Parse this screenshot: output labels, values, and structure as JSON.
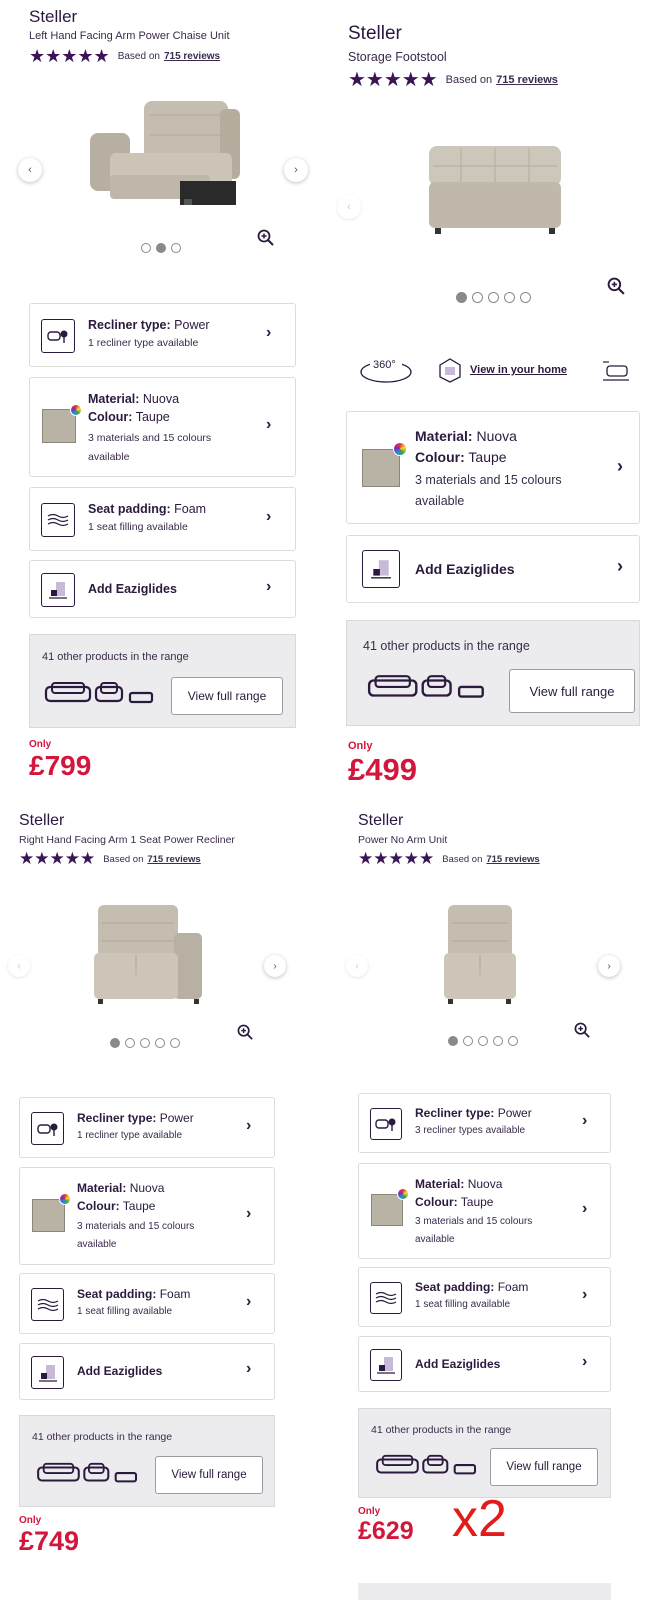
{
  "panels": [
    {
      "brand": "Steller",
      "name": "Left Hand Facing Arm Power Chaise Unit",
      "rating": {
        "stars": "★★★★★",
        "based_on": "Based on",
        "reviews": "715 reviews"
      },
      "carousel": {
        "slides": 3,
        "active": 2
      },
      "options": [
        {
          "type": "recliner",
          "label": "Recliner type:",
          "value": "Power",
          "sub": "1 recliner type available"
        },
        {
          "type": "material",
          "label": "Material:",
          "value": "Nuova",
          "label2": "Colour:",
          "value2": "Taupe",
          "sub": "3 materials and 15 colours available"
        },
        {
          "type": "padding",
          "label": "Seat padding:",
          "value": "Foam",
          "sub": "1 seat filling available"
        },
        {
          "type": "glides",
          "label": "Add Eaziglides"
        }
      ],
      "range": {
        "text": "41 other products in the range",
        "button": "View full range"
      },
      "price": {
        "prefix": "Only",
        "value": "£799"
      }
    },
    {
      "brand": "Steller",
      "name": "Storage Footstool",
      "rating": {
        "stars": "★★★★★",
        "based_on": "Based on",
        "reviews": "715 reviews"
      },
      "carousel": {
        "slides": 5,
        "active": 1
      },
      "tools": {
        "rotate": "360°",
        "view_home": "View in your home"
      },
      "options": [
        {
          "type": "material",
          "label": "Material:",
          "value": "Nuova",
          "label2": "Colour:",
          "value2": "Taupe",
          "sub": "3 materials and 15 colours available"
        },
        {
          "type": "glides",
          "label": "Add Eaziglides"
        }
      ],
      "range": {
        "text": "41 other products in the range",
        "button": "View full range"
      },
      "price": {
        "prefix": "Only",
        "value": "£499"
      }
    },
    {
      "brand": "Steller",
      "name": "Right Hand Facing Arm 1 Seat Power Recliner",
      "rating": {
        "stars": "★★★★★",
        "based_on": "Based on",
        "reviews": "715 reviews"
      },
      "carousel": {
        "slides": 5,
        "active": 1
      },
      "options": [
        {
          "type": "recliner",
          "label": "Recliner type:",
          "value": "Power",
          "sub": "1 recliner type available"
        },
        {
          "type": "material",
          "label": "Material:",
          "value": "Nuova",
          "label2": "Colour:",
          "value2": "Taupe",
          "sub": "3 materials and 15 colours available"
        },
        {
          "type": "padding",
          "label": "Seat padding:",
          "value": "Foam",
          "sub": "1 seat filling available"
        },
        {
          "type": "glides",
          "label": "Add Eaziglides"
        }
      ],
      "range": {
        "text": "41 other products in the range",
        "button": "View full range"
      },
      "price": {
        "prefix": "Only",
        "value": "£749"
      }
    },
    {
      "brand": "Steller",
      "name": "Power No Arm Unit",
      "rating": {
        "stars": "★★★★★",
        "based_on": "Based on",
        "reviews": "715 reviews"
      },
      "carousel": {
        "slides": 5,
        "active": 1
      },
      "options": [
        {
          "type": "recliner",
          "label": "Recliner type:",
          "value": "Power",
          "sub": "3 recliner types available"
        },
        {
          "type": "material",
          "label": "Material:",
          "value": "Nuova",
          "label2": "Colour:",
          "value2": "Taupe",
          "sub": "3 materials and 15 colours available"
        },
        {
          "type": "padding",
          "label": "Seat padding:",
          "value": "Foam",
          "sub": "1 seat filling available"
        },
        {
          "type": "glides",
          "label": "Add Eaziglides"
        }
      ],
      "range": {
        "text": "41 other products in the range",
        "button": "View full range"
      },
      "price": {
        "prefix": "Only",
        "value": "£629"
      },
      "annotation": "x2"
    }
  ],
  "colors": {
    "brand_purple": "#2b1a3d",
    "price_red": "#d3163b",
    "annotation_red": "#e21b1b",
    "fabric": "#b9b3a6"
  }
}
